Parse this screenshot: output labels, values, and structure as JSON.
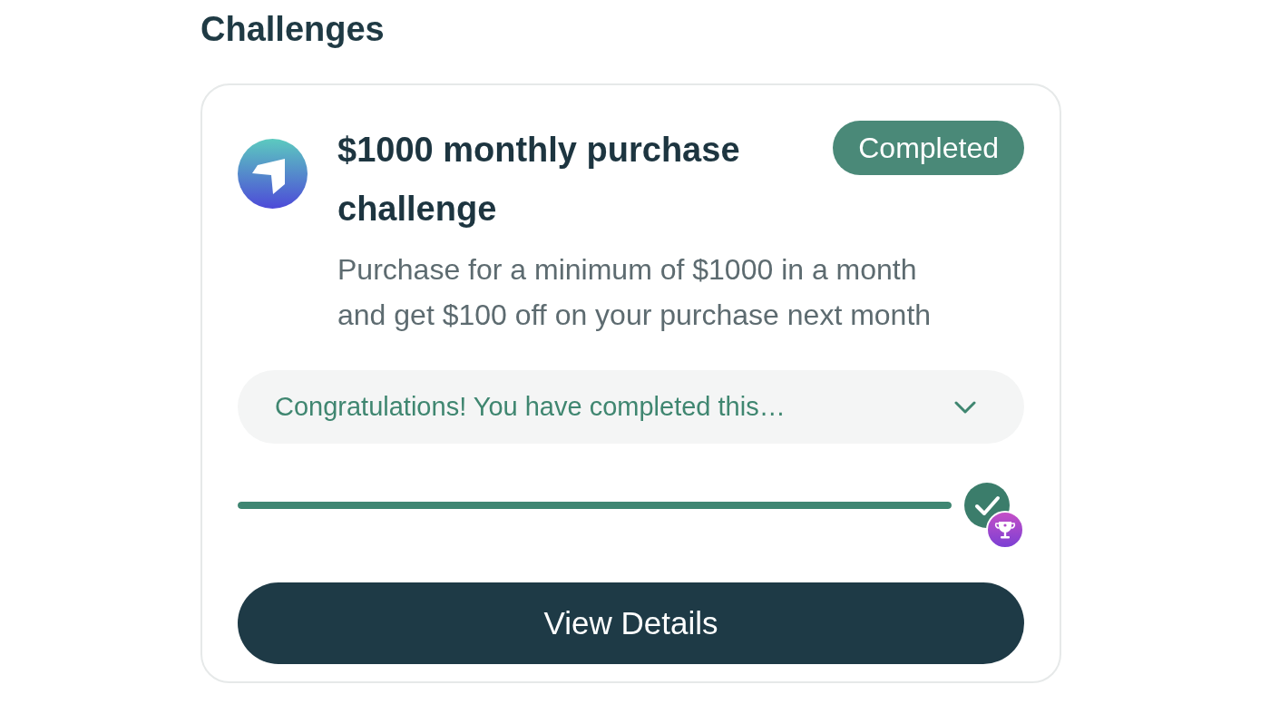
{
  "section": {
    "title": "Challenges"
  },
  "challenge": {
    "title": "$1000 monthly purchase challenge",
    "status": {
      "label": "Completed",
      "kind": "completed"
    },
    "description": "Purchase for a minimum of $1000 in a month and get $100 off on your purchase next month",
    "message": {
      "text": "Congratulations! You have completed this…",
      "expanded": false
    },
    "progress": {
      "level": 1,
      "completed": true
    },
    "button": "View Details"
  }
}
